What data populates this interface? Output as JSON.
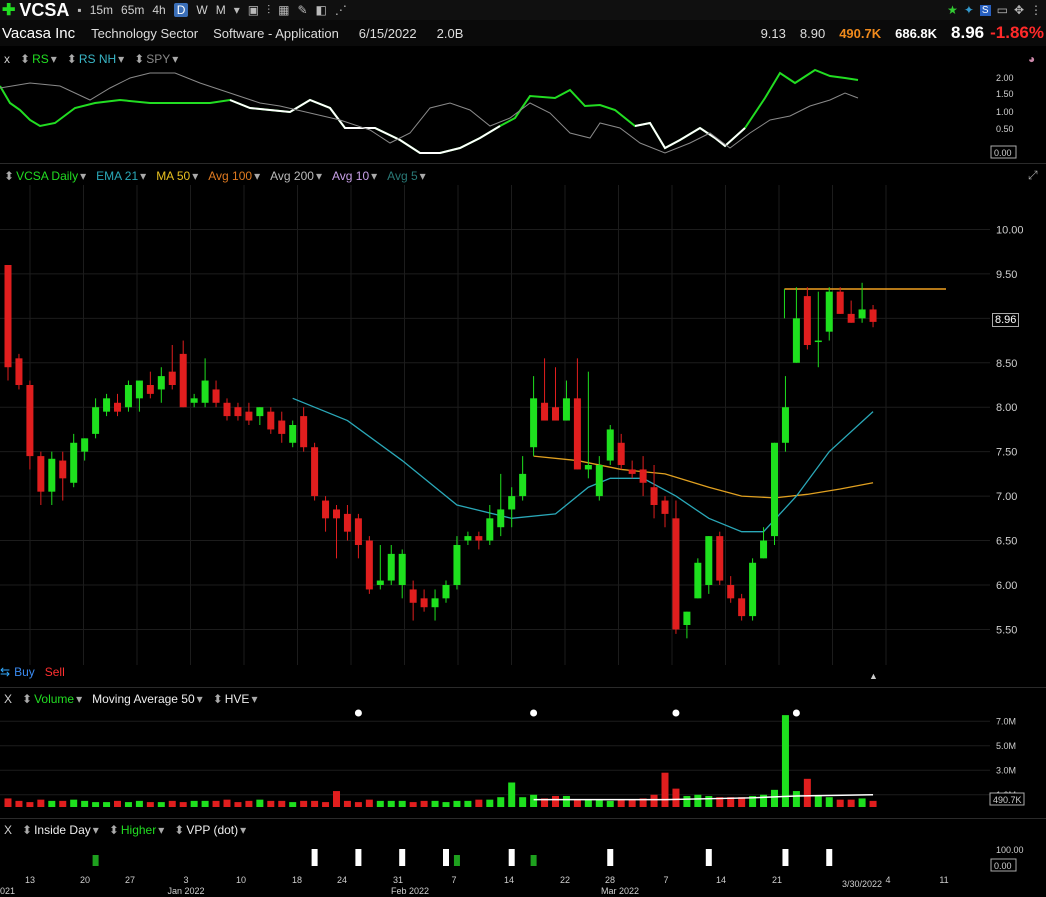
{
  "toolbar": {
    "symbol": "VCSA",
    "intervals": [
      "15m",
      "65m",
      "4h",
      "D",
      "W",
      "M"
    ],
    "active_interval": "D"
  },
  "info": {
    "company": "Vacasa Inc",
    "sector": "Technology Sector",
    "industry": "Software - Application",
    "date": "6/15/2022",
    "shares": "2.0B",
    "v1": "9.13",
    "v2": "8.90",
    "vol": "490.7K",
    "avgvol": "686.8K",
    "price": "8.96",
    "change": "-1.86%"
  },
  "colors": {
    "up": "#1ee01e",
    "down": "#e01e1e",
    "ema21": "#2aa8b8",
    "ma50": "#e0a020",
    "rs": "#22dd22",
    "spy": "#888888"
  },
  "rs_legend": {
    "close": "x",
    "rs": "RS",
    "rsnh": "RS NH",
    "spy": "SPY",
    "ticks": [
      "2.00",
      "1.50",
      "1.00",
      "0.50"
    ],
    "box": "0.00"
  },
  "main_legend": {
    "title": "VCSA Daily",
    "ema": "EMA 21",
    "ma": "MA 50",
    "avg100": "Avg 100",
    "avg200": "Avg 200",
    "avg10": "Avg 10",
    "avg5": "Avg 5",
    "buy": "Buy",
    "sell": "Sell",
    "price_box": "8.96"
  },
  "vol_legend": {
    "close": "X",
    "volume": "Volume",
    "ma": "Moving Average 50",
    "hve": "HVE",
    "ticks": [
      "7.0M",
      "5.0M",
      "3.0M",
      "1.0M"
    ],
    "box": "490.7K"
  },
  "ind_legend": {
    "close": "X",
    "inside": "Inside Day",
    "higher": "Higher",
    "vpp": "VPP (dot)",
    "ticks": [
      "100.00"
    ],
    "box": "0.00"
  },
  "x_axis": {
    "labels": [
      "13",
      "20",
      "27",
      "3",
      "10",
      "18",
      "24",
      "31",
      "7",
      "14",
      "22",
      "28",
      "7",
      "14",
      "21",
      "4",
      "11"
    ],
    "months": [
      "Jan 2022",
      "Feb 2022",
      "Mar 2022"
    ],
    "edge_left": "021",
    "edge_right": "3/30/2022"
  },
  "chart_data": {
    "type": "candlestick",
    "y_ticks": [
      10.0,
      9.5,
      9.0,
      8.5,
      8.0,
      7.5,
      7.0,
      6.5,
      6.0,
      5.5
    ],
    "y_tick_labels": [
      "10.00",
      "9.50",
      "9.00",
      "8.50",
      "8.00",
      "7.50",
      "7.00",
      "6.50",
      "6.00",
      "5.50"
    ],
    "ylim": [
      5.1,
      10.5
    ],
    "resistance": 9.33,
    "candles": [
      {
        "o": 9.6,
        "h": 9.6,
        "l": 8.3,
        "c": 8.45
      },
      {
        "o": 8.55,
        "h": 8.6,
        "l": 8.2,
        "c": 8.25
      },
      {
        "o": 8.25,
        "h": 8.3,
        "l": 7.3,
        "c": 7.45
      },
      {
        "o": 7.45,
        "h": 7.5,
        "l": 6.9,
        "c": 7.05
      },
      {
        "o": 7.05,
        "h": 7.5,
        "l": 6.9,
        "c": 7.42
      },
      {
        "o": 7.4,
        "h": 7.5,
        "l": 6.95,
        "c": 7.2
      },
      {
        "o": 7.15,
        "h": 7.7,
        "l": 7.1,
        "c": 7.6
      },
      {
        "o": 7.5,
        "h": 7.65,
        "l": 7.4,
        "c": 7.65
      },
      {
        "o": 7.7,
        "h": 8.1,
        "l": 7.65,
        "c": 8.0
      },
      {
        "o": 7.95,
        "h": 8.15,
        "l": 7.9,
        "c": 8.1
      },
      {
        "o": 8.05,
        "h": 8.15,
        "l": 7.9,
        "c": 7.95
      },
      {
        "o": 8.0,
        "h": 8.3,
        "l": 7.95,
        "c": 8.25
      },
      {
        "o": 8.1,
        "h": 8.3,
        "l": 7.95,
        "c": 8.3
      },
      {
        "o": 8.25,
        "h": 8.4,
        "l": 8.1,
        "c": 8.15
      },
      {
        "o": 8.2,
        "h": 8.45,
        "l": 8.05,
        "c": 8.35
      },
      {
        "o": 8.4,
        "h": 8.7,
        "l": 8.2,
        "c": 8.25
      },
      {
        "o": 8.6,
        "h": 8.75,
        "l": 8.0,
        "c": 8.0
      },
      {
        "o": 8.05,
        "h": 8.15,
        "l": 8.0,
        "c": 8.1
      },
      {
        "o": 8.05,
        "h": 8.55,
        "l": 8.0,
        "c": 8.3
      },
      {
        "o": 8.2,
        "h": 8.3,
        "l": 8.0,
        "c": 8.05
      },
      {
        "o": 8.05,
        "h": 8.1,
        "l": 7.85,
        "c": 7.9
      },
      {
        "o": 8.0,
        "h": 8.05,
        "l": 7.85,
        "c": 7.9
      },
      {
        "o": 7.95,
        "h": 8.05,
        "l": 7.8,
        "c": 7.85
      },
      {
        "o": 7.9,
        "h": 8.0,
        "l": 7.8,
        "c": 8.0
      },
      {
        "o": 7.95,
        "h": 8.0,
        "l": 7.7,
        "c": 7.75
      },
      {
        "o": 7.85,
        "h": 7.95,
        "l": 7.6,
        "c": 7.7
      },
      {
        "o": 7.6,
        "h": 7.85,
        "l": 7.55,
        "c": 7.8
      },
      {
        "o": 7.9,
        "h": 8.0,
        "l": 7.5,
        "c": 7.55
      },
      {
        "o": 7.55,
        "h": 7.6,
        "l": 6.95,
        "c": 7.0
      },
      {
        "o": 6.95,
        "h": 7.0,
        "l": 6.6,
        "c": 6.75
      },
      {
        "o": 6.85,
        "h": 6.9,
        "l": 6.3,
        "c": 6.75
      },
      {
        "o": 6.8,
        "h": 6.9,
        "l": 6.5,
        "c": 6.6
      },
      {
        "o": 6.75,
        "h": 6.8,
        "l": 6.3,
        "c": 6.45
      },
      {
        "o": 6.5,
        "h": 6.55,
        "l": 5.9,
        "c": 5.95
      },
      {
        "o": 6.0,
        "h": 6.45,
        "l": 5.95,
        "c": 6.05
      },
      {
        "o": 6.05,
        "h": 6.45,
        "l": 6.0,
        "c": 6.35
      },
      {
        "o": 6.0,
        "h": 6.4,
        "l": 5.85,
        "c": 6.35
      },
      {
        "o": 5.95,
        "h": 6.05,
        "l": 5.6,
        "c": 5.8
      },
      {
        "o": 5.85,
        "h": 5.95,
        "l": 5.7,
        "c": 5.75
      },
      {
        "o": 5.75,
        "h": 5.95,
        "l": 5.6,
        "c": 5.85
      },
      {
        "o": 5.85,
        "h": 6.05,
        "l": 5.8,
        "c": 6.0
      },
      {
        "o": 6.0,
        "h": 6.55,
        "l": 5.95,
        "c": 6.45
      },
      {
        "o": 6.5,
        "h": 6.6,
        "l": 6.45,
        "c": 6.55
      },
      {
        "o": 6.55,
        "h": 6.6,
        "l": 6.4,
        "c": 6.5
      },
      {
        "o": 6.5,
        "h": 6.9,
        "l": 6.45,
        "c": 6.75
      },
      {
        "o": 6.65,
        "h": 7.25,
        "l": 6.55,
        "c": 6.85
      },
      {
        "o": 6.85,
        "h": 7.1,
        "l": 6.65,
        "c": 7.0
      },
      {
        "o": 7.0,
        "h": 7.45,
        "l": 6.95,
        "c": 7.25
      },
      {
        "o": 7.55,
        "h": 8.35,
        "l": 7.45,
        "c": 8.1
      },
      {
        "o": 8.05,
        "h": 8.55,
        "l": 7.9,
        "c": 7.85
      },
      {
        "o": 8.0,
        "h": 8.45,
        "l": 7.85,
        "c": 7.85
      },
      {
        "o": 7.85,
        "h": 8.3,
        "l": 7.85,
        "c": 8.1
      },
      {
        "o": 8.1,
        "h": 8.55,
        "l": 7.3,
        "c": 7.3
      },
      {
        "o": 7.3,
        "h": 8.4,
        "l": 7.2,
        "c": 7.35
      },
      {
        "o": 7.0,
        "h": 7.45,
        "l": 6.95,
        "c": 7.35
      },
      {
        "o": 7.4,
        "h": 7.8,
        "l": 7.35,
        "c": 7.75
      },
      {
        "o": 7.6,
        "h": 7.7,
        "l": 7.3,
        "c": 7.35
      },
      {
        "o": 7.3,
        "h": 7.4,
        "l": 7.2,
        "c": 7.25
      },
      {
        "o": 7.3,
        "h": 7.45,
        "l": 7.0,
        "c": 7.15
      },
      {
        "o": 7.1,
        "h": 7.35,
        "l": 6.75,
        "c": 6.9
      },
      {
        "o": 6.95,
        "h": 7.0,
        "l": 6.65,
        "c": 6.8
      },
      {
        "o": 6.75,
        "h": 6.95,
        "l": 5.45,
        "c": 5.5
      },
      {
        "o": 5.55,
        "h": 5.7,
        "l": 5.4,
        "c": 5.7
      },
      {
        "o": 5.85,
        "h": 6.3,
        "l": 5.85,
        "c": 6.25
      },
      {
        "o": 6.0,
        "h": 6.55,
        "l": 5.9,
        "c": 6.55
      },
      {
        "o": 6.55,
        "h": 6.6,
        "l": 6.0,
        "c": 6.05
      },
      {
        "o": 6.0,
        "h": 6.1,
        "l": 5.8,
        "c": 5.85
      },
      {
        "o": 5.85,
        "h": 5.9,
        "l": 5.6,
        "c": 5.65
      },
      {
        "o": 5.65,
        "h": 6.3,
        "l": 5.6,
        "c": 6.25
      },
      {
        "o": 6.3,
        "h": 6.65,
        "l": 6.3,
        "c": 6.5
      },
      {
        "o": 6.55,
        "h": 7.6,
        "l": 6.45,
        "c": 7.6
      },
      {
        "o": 7.6,
        "h": 8.35,
        "l": 7.5,
        "c": 8.0
      },
      {
        "o": 8.5,
        "h": 9.35,
        "l": 8.5,
        "c": 9.0
      },
      {
        "o": 9.25,
        "h": 9.35,
        "l": 8.65,
        "c": 8.7
      },
      {
        "o": 8.75,
        "h": 9.3,
        "l": 8.45,
        "c": 8.75
      },
      {
        "o": 8.85,
        "h": 9.35,
        "l": 8.75,
        "c": 9.3
      },
      {
        "o": 9.3,
        "h": 9.35,
        "l": 9.05,
        "c": 9.05
      },
      {
        "o": 9.05,
        "h": 9.2,
        "l": 8.95,
        "c": 8.95
      },
      {
        "o": 9.0,
        "h": 9.4,
        "l": 8.95,
        "c": 9.1
      },
      {
        "o": 9.1,
        "h": 9.15,
        "l": 8.9,
        "c": 8.96
      }
    ],
    "ema21": [
      [
        26,
        8.1
      ],
      [
        31,
        7.85
      ],
      [
        36,
        7.4
      ],
      [
        41,
        6.9
      ],
      [
        46,
        6.75
      ],
      [
        50,
        6.8
      ],
      [
        53,
        7.1
      ],
      [
        55,
        7.2
      ],
      [
        58,
        7.2
      ],
      [
        61,
        7.0
      ],
      [
        64,
        6.75
      ],
      [
        67,
        6.6
      ],
      [
        69,
        6.6
      ],
      [
        72,
        7.0
      ],
      [
        75,
        7.5
      ],
      [
        79,
        7.95
      ]
    ],
    "ma50": [
      [
        48,
        7.45
      ],
      [
        52,
        7.4
      ],
      [
        56,
        7.3
      ],
      [
        60,
        7.25
      ],
      [
        64,
        7.1
      ],
      [
        67,
        7.0
      ],
      [
        70,
        6.98
      ],
      [
        73,
        7.02
      ],
      [
        76,
        7.08
      ],
      [
        79,
        7.15
      ]
    ],
    "volume": {
      "ylim": [
        0,
        8.0
      ],
      "ticks": [
        7.0,
        5.0,
        3.0,
        1.0
      ],
      "values": [
        0.7,
        0.5,
        0.4,
        0.6,
        0.5,
        0.5,
        0.6,
        0.5,
        0.4,
        0.4,
        0.5,
        0.4,
        0.5,
        0.4,
        0.4,
        0.5,
        0.4,
        0.5,
        0.5,
        0.5,
        0.6,
        0.4,
        0.5,
        0.6,
        0.5,
        0.5,
        0.4,
        0.5,
        0.5,
        0.4,
        1.3,
        0.5,
        0.4,
        0.6,
        0.5,
        0.5,
        0.5,
        0.4,
        0.5,
        0.5,
        0.4,
        0.5,
        0.5,
        0.6,
        0.6,
        0.8,
        2.0,
        0.8,
        1.0,
        0.7,
        0.9,
        0.9,
        0.6,
        0.6,
        0.6,
        0.5,
        0.6,
        0.6,
        0.7,
        1.0,
        2.8,
        1.5,
        0.9,
        1.0,
        0.9,
        0.8,
        0.8,
        0.8,
        0.9,
        1.0,
        1.4,
        7.5,
        1.3,
        2.3,
        0.9,
        0.8,
        0.6,
        0.6,
        0.7,
        0.5
      ],
      "ma50": [
        [
          48,
          0.6
        ],
        [
          60,
          0.6
        ],
        [
          68,
          0.75
        ],
        [
          72,
          0.9
        ],
        [
          79,
          1.0
        ]
      ],
      "hve_dots": [
        32,
        48,
        61,
        72
      ]
    }
  }
}
